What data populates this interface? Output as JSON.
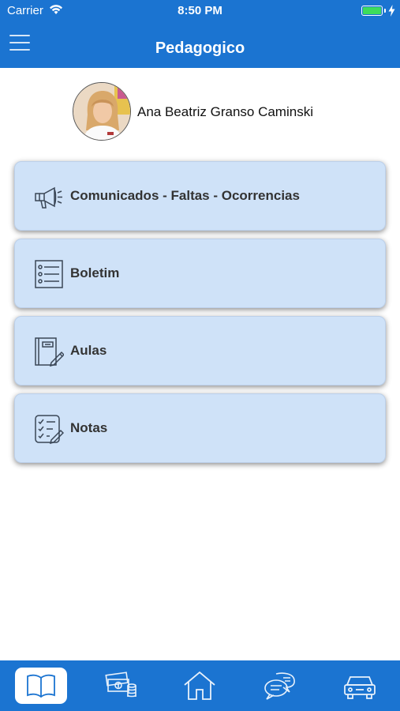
{
  "status_bar": {
    "carrier": "Carrier",
    "time": "8:50 PM"
  },
  "nav": {
    "title": "Pedagogico",
    "menu_icon": "hamburger-menu-icon"
  },
  "profile": {
    "name": "Ana Beatriz Granso Caminski"
  },
  "menu": [
    {
      "label": "Comunicados - Faltas - Ocorrencias",
      "icon": "megaphone-icon"
    },
    {
      "label": "Boletim",
      "icon": "report-list-icon"
    },
    {
      "label": "Aulas",
      "icon": "notebook-icon"
    },
    {
      "label": "Notas",
      "icon": "checklist-icon"
    }
  ],
  "tabs": [
    {
      "icon": "book-icon",
      "active": true
    },
    {
      "icon": "money-icon",
      "active": false
    },
    {
      "icon": "home-icon",
      "active": false
    },
    {
      "icon": "chat-icon",
      "active": false
    },
    {
      "icon": "car-icon",
      "active": false
    }
  ],
  "colors": {
    "primary": "#1b74d1",
    "card": "#cfe2f8",
    "icon": "#3a4656"
  }
}
